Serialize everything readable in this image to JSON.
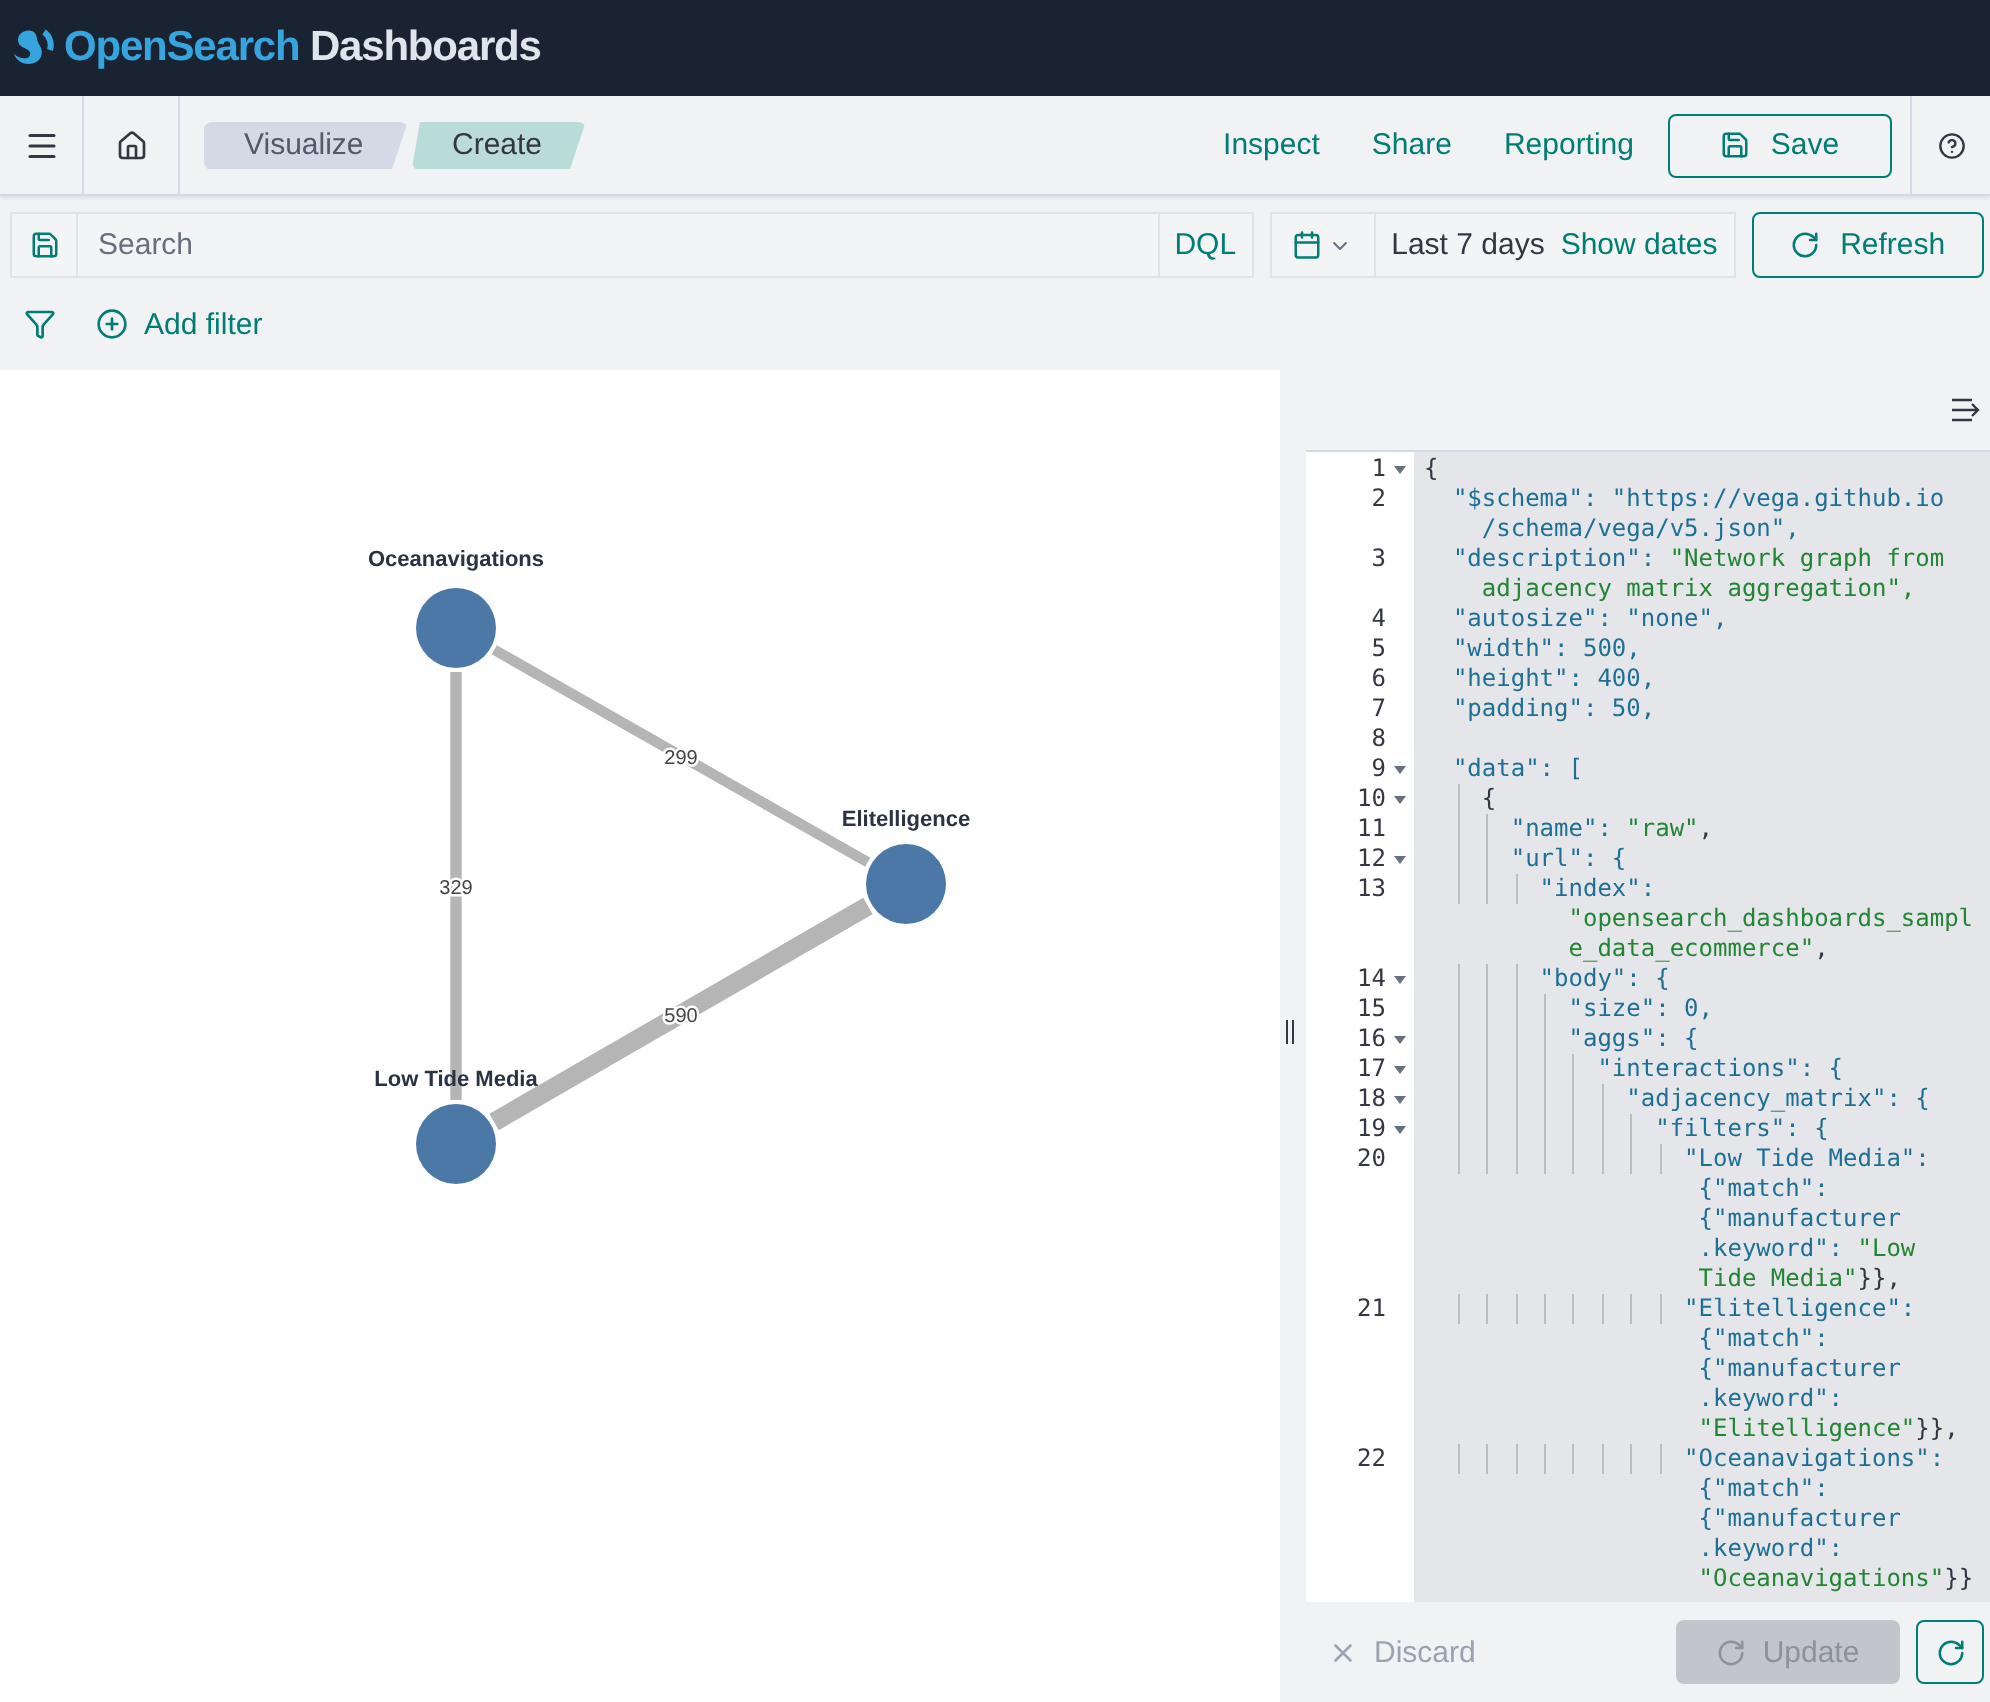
{
  "header": {
    "brand": "OpenSearch",
    "product": "Dashboards"
  },
  "breadcrumbs": [
    {
      "label": "Visualize",
      "selected": false
    },
    {
      "label": "Create",
      "selected": true
    }
  ],
  "top_nav_links": [
    "Inspect",
    "Share",
    "Reporting"
  ],
  "save_button": "Save",
  "query_bar": {
    "placeholder": "Search",
    "language": "DQL",
    "time_range": "Last 7 days",
    "show_dates": "Show dates",
    "refresh": "Refresh"
  },
  "filter_bar": {
    "add_filter": "Add filter"
  },
  "graph": {
    "nodes": [
      {
        "label": "Oceanavigations"
      },
      {
        "label": "Elitelligence"
      },
      {
        "label": "Low Tide Media"
      }
    ],
    "edges": [
      {
        "label": "299"
      },
      {
        "label": "329"
      },
      {
        "label": "590"
      }
    ]
  },
  "editor": {
    "lines": [
      {
        "number": "1",
        "foldable": true,
        "rows": [
          {
            "parts": [
              {
                "kind": "punct",
                "text": "{"
              }
            ]
          }
        ]
      },
      {
        "number": "2",
        "foldable": false,
        "rows": [
          {
            "parts": [
              {
                "kind": "key",
                "text": "  \"$schema\": "
              },
              {
                "kind": "key",
                "text": "\"https://vega.github.io"
              }
            ]
          },
          {
            "parts": [
              {
                "kind": "key",
                "text": "    /schema/vega/v5.json\","
              }
            ]
          }
        ]
      },
      {
        "number": "3",
        "foldable": false,
        "rows": [
          {
            "parts": [
              {
                "kind": "key",
                "text": "  \"description\": "
              },
              {
                "kind": "str",
                "text": "\"Network graph from"
              }
            ]
          },
          {
            "parts": [
              {
                "kind": "str",
                "text": "    adjacency matrix aggregation\","
              }
            ]
          }
        ]
      },
      {
        "number": "4",
        "foldable": false,
        "rows": [
          {
            "parts": [
              {
                "kind": "key",
                "text": "  \"autosize\": \"none\","
              }
            ]
          }
        ]
      },
      {
        "number": "5",
        "foldable": false,
        "rows": [
          {
            "parts": [
              {
                "kind": "key",
                "text": "  \"width\": 500,"
              }
            ]
          }
        ]
      },
      {
        "number": "6",
        "foldable": false,
        "rows": [
          {
            "parts": [
              {
                "kind": "key",
                "text": "  \"height\": 400,"
              }
            ]
          }
        ]
      },
      {
        "number": "7",
        "foldable": false,
        "rows": [
          {
            "parts": [
              {
                "kind": "key",
                "text": "  \"padding\": 50,"
              }
            ]
          }
        ]
      },
      {
        "number": "8",
        "foldable": false
      },
      {
        "number": "9",
        "foldable": true,
        "rows": [
          {
            "parts": [
              {
                "kind": "key",
                "text": "  \"data\": ["
              }
            ]
          }
        ]
      },
      {
        "number": "10",
        "foldable": true,
        "rows": [
          {
            "parts": [
              {
                "kind": "punct",
                "text": "    {"
              }
            ]
          }
        ]
      },
      {
        "number": "11",
        "foldable": false,
        "rows": [
          {
            "parts": [
              {
                "kind": "key",
                "text": "      \"name\": "
              },
              {
                "kind": "str",
                "text": "\"raw\""
              },
              {
                "kind": "punct",
                "text": ","
              }
            ]
          }
        ]
      },
      {
        "number": "12",
        "foldable": true,
        "rows": [
          {
            "parts": [
              {
                "kind": "key",
                "text": "      \"url\": {"
              }
            ]
          }
        ]
      },
      {
        "number": "13",
        "foldable": false,
        "rows": [
          {
            "parts": [
              {
                "kind": "key",
                "text": "        \"index\":"
              }
            ]
          },
          {
            "parts": [
              {
                "kind": "str",
                "text": "          \"opensearch_dashboards_sampl"
              }
            ]
          },
          {
            "parts": [
              {
                "kind": "str",
                "text": "          e_data_ecommerce\""
              },
              {
                "kind": "punct",
                "text": ","
              }
            ]
          }
        ]
      },
      {
        "number": "14",
        "foldable": true,
        "rows": [
          {
            "parts": [
              {
                "kind": "key",
                "text": "        \"body\": {"
              }
            ]
          }
        ]
      },
      {
        "number": "15",
        "foldable": false,
        "rows": [
          {
            "parts": [
              {
                "kind": "key",
                "text": "          \"size\": 0,"
              }
            ]
          }
        ]
      },
      {
        "number": "16",
        "foldable": true,
        "rows": [
          {
            "parts": [
              {
                "kind": "key",
                "text": "          \"aggs\": {"
              }
            ]
          }
        ]
      },
      {
        "number": "17",
        "foldable": true,
        "rows": [
          {
            "parts": [
              {
                "kind": "key",
                "text": "            \"interactions\": {"
              }
            ]
          }
        ]
      },
      {
        "number": "18",
        "foldable": true,
        "rows": [
          {
            "parts": [
              {
                "kind": "key",
                "text": "              \"adjacency_matrix\": {"
              }
            ]
          }
        ]
      },
      {
        "number": "19",
        "foldable": true,
        "rows": [
          {
            "parts": [
              {
                "kind": "key",
                "text": "                \"filters\": {"
              }
            ]
          }
        ]
      },
      {
        "number": "20",
        "foldable": false,
        "rows": [
          {
            "parts": [
              {
                "kind": "key",
                "text": "                  \"Low Tide Media\":"
              }
            ]
          },
          {
            "parts": [
              {
                "kind": "key",
                "text": "                   {\"match\":"
              }
            ]
          },
          {
            "parts": [
              {
                "kind": "key",
                "text": "                   {\"manufacturer"
              }
            ]
          },
          {
            "parts": [
              {
                "kind": "key",
                "text": "                   .keyword\": "
              },
              {
                "kind": "str",
                "text": "\"Low"
              }
            ]
          },
          {
            "parts": [
              {
                "kind": "str",
                "text": "                   Tide Media\""
              },
              {
                "kind": "punct",
                "text": "}},"
              }
            ]
          }
        ]
      },
      {
        "number": "21",
        "foldable": false,
        "rows": [
          {
            "parts": [
              {
                "kind": "key",
                "text": "                  \"Elitelligence\":"
              }
            ]
          },
          {
            "parts": [
              {
                "kind": "key",
                "text": "                   {\"match\":"
              }
            ]
          },
          {
            "parts": [
              {
                "kind": "key",
                "text": "                   {\"manufacturer"
              }
            ]
          },
          {
            "parts": [
              {
                "kind": "key",
                "text": "                   .keyword\":"
              }
            ]
          },
          {
            "parts": [
              {
                "kind": "str",
                "text": "                   \"Elitelligence\""
              },
              {
                "kind": "punct",
                "text": "}},"
              }
            ]
          }
        ]
      },
      {
        "number": "22",
        "foldable": false,
        "rows": [
          {
            "parts": [
              {
                "kind": "key",
                "text": "                  \"Oceanavigations\":"
              }
            ]
          },
          {
            "parts": [
              {
                "kind": "key",
                "text": "                   {\"match\":"
              }
            ]
          },
          {
            "parts": [
              {
                "kind": "key",
                "text": "                   {\"manufacturer"
              }
            ]
          },
          {
            "parts": [
              {
                "kind": "key",
                "text": "                   .keyword\":"
              }
            ]
          },
          {
            "parts": [
              {
                "kind": "str",
                "text": "                   \"Oceanavigations\""
              },
              {
                "kind": "punct",
                "text": "}}"
              }
            ]
          }
        ]
      }
    ]
  },
  "footer": {
    "discard": "Discard",
    "update": {
      "label": "Update",
      "disabled": true
    }
  }
}
